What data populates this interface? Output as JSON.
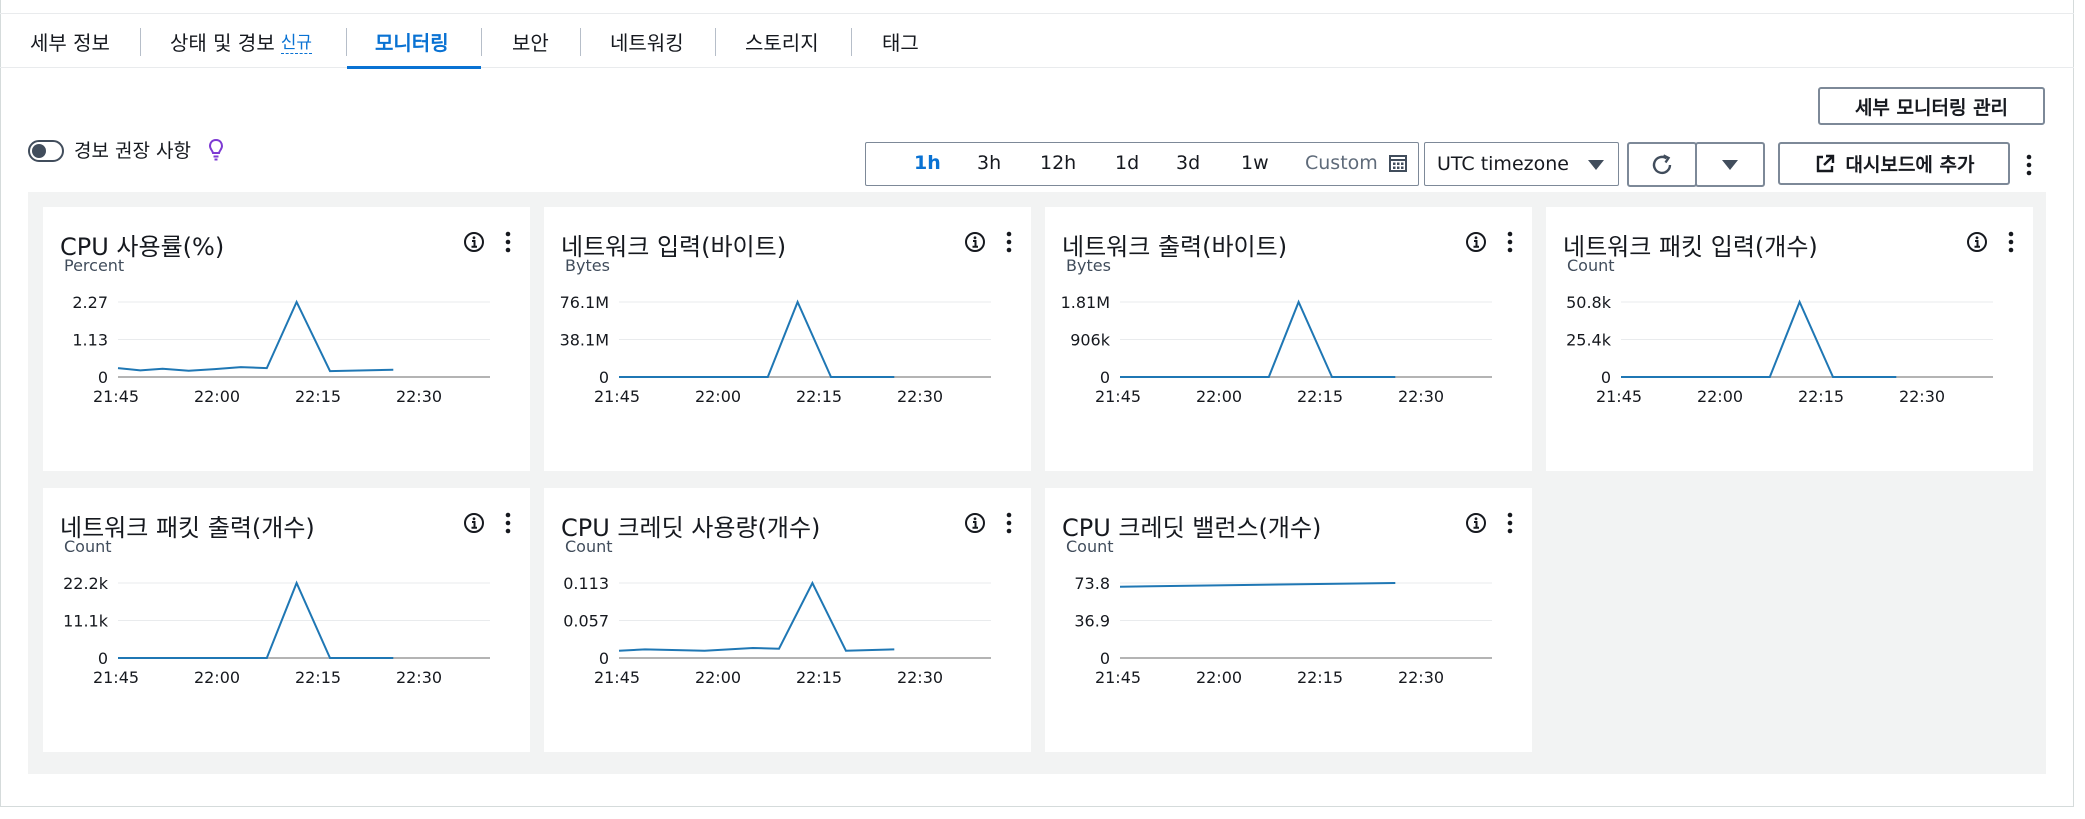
{
  "tabs": [
    {
      "label": "세부 정보"
    },
    {
      "label": "상태 및 경보",
      "badge": "신규"
    },
    {
      "label": "모니터링",
      "active": true
    },
    {
      "label": "보안"
    },
    {
      "label": "네트워킹"
    },
    {
      "label": "스토리지"
    },
    {
      "label": "태그"
    }
  ],
  "toolbar": {
    "manage_detailed_monitoring": "세부 모니터링 관리",
    "alarm_recommendations": "경보 권장 사항",
    "time_ranges": [
      "1h",
      "3h",
      "12h",
      "1d",
      "3d",
      "1w"
    ],
    "active_range": "1h",
    "custom_label": "Custom",
    "timezone": "UTC timezone",
    "add_to_dashboard": "대시보드에 추가"
  },
  "colors": {
    "accent": "#0972d3",
    "series": "#1f77b4",
    "dashboard_bg": "#f2f3f3"
  },
  "chart_data": [
    {
      "type": "line",
      "title": "CPU 사용률(%)",
      "ylabel": "Percent",
      "x": [
        "21:45",
        "22:00",
        "22:15",
        "22:30"
      ],
      "yticks": [
        "0",
        "1.13",
        "2.27"
      ],
      "ylim": [
        0,
        2.27
      ],
      "series": [
        {
          "values": [
            [
              0,
              0.27
            ],
            [
              0.06,
              0.2
            ],
            [
              0.12,
              0.25
            ],
            [
              0.19,
              0.19
            ],
            [
              0.26,
              0.24
            ],
            [
              0.33,
              0.3
            ],
            [
              0.4,
              0.27
            ],
            [
              0.48,
              2.27
            ],
            [
              0.57,
              0.18
            ],
            [
              0.74,
              0.22
            ]
          ]
        }
      ]
    },
    {
      "type": "line",
      "title": "네트워크 입력(바이트)",
      "ylabel": "Bytes",
      "x": [
        "21:45",
        "22:00",
        "22:15",
        "22:30"
      ],
      "yticks": [
        "0",
        "38.1M",
        "76.1M"
      ],
      "ylim": [
        0,
        76.1
      ],
      "series": [
        {
          "values": [
            [
              0,
              0
            ],
            [
              0.4,
              0
            ],
            [
              0.48,
              76.1
            ],
            [
              0.57,
              0
            ],
            [
              0.74,
              0
            ]
          ]
        }
      ]
    },
    {
      "type": "line",
      "title": "네트워크 출력(바이트)",
      "ylabel": "Bytes",
      "x": [
        "21:45",
        "22:00",
        "22:15",
        "22:30"
      ],
      "yticks": [
        "0",
        "906k",
        "1.81M"
      ],
      "ylim": [
        0,
        1.81
      ],
      "series": [
        {
          "values": [
            [
              0,
              0
            ],
            [
              0.4,
              0
            ],
            [
              0.48,
              1.81
            ],
            [
              0.57,
              0
            ],
            [
              0.74,
              0
            ]
          ]
        }
      ]
    },
    {
      "type": "line",
      "title": "네트워크 패킷 입력(개수)",
      "ylabel": "Count",
      "x": [
        "21:45",
        "22:00",
        "22:15",
        "22:30"
      ],
      "yticks": [
        "0",
        "25.4k",
        "50.8k"
      ],
      "ylim": [
        0,
        50.8
      ],
      "series": [
        {
          "values": [
            [
              0,
              0
            ],
            [
              0.4,
              0
            ],
            [
              0.48,
              50.8
            ],
            [
              0.57,
              0
            ],
            [
              0.74,
              0
            ]
          ]
        }
      ]
    },
    {
      "type": "line",
      "title": "네트워크 패킷 출력(개수)",
      "ylabel": "Count",
      "x": [
        "21:45",
        "22:00",
        "22:15",
        "22:30"
      ],
      "yticks": [
        "0",
        "11.1k",
        "22.2k"
      ],
      "ylim": [
        0,
        22.2
      ],
      "series": [
        {
          "values": [
            [
              0,
              0
            ],
            [
              0.4,
              0
            ],
            [
              0.48,
              22.2
            ],
            [
              0.57,
              0
            ],
            [
              0.74,
              0
            ]
          ]
        }
      ]
    },
    {
      "type": "line",
      "title": "CPU 크레딧 사용량(개수)",
      "ylabel": "Count",
      "x": [
        "21:45",
        "22:00",
        "22:15",
        "22:30"
      ],
      "yticks": [
        "0",
        "0.057",
        "0.113"
      ],
      "ylim": [
        0,
        0.113
      ],
      "series": [
        {
          "values": [
            [
              0,
              0.011
            ],
            [
              0.07,
              0.013
            ],
            [
              0.23,
              0.011
            ],
            [
              0.36,
              0.015
            ],
            [
              0.43,
              0.014
            ],
            [
              0.52,
              0.113
            ],
            [
              0.61,
              0.011
            ],
            [
              0.74,
              0.013
            ]
          ]
        }
      ]
    },
    {
      "type": "line",
      "title": "CPU 크레딧 밸런스(개수)",
      "ylabel": "Count",
      "x": [
        "21:45",
        "22:00",
        "22:15",
        "22:30"
      ],
      "yticks": [
        "0",
        "36.9",
        "73.8"
      ],
      "ylim": [
        0,
        73.8
      ],
      "series": [
        {
          "values": [
            [
              0,
              70.2
            ],
            [
              0.74,
              73.8
            ]
          ]
        }
      ]
    }
  ]
}
